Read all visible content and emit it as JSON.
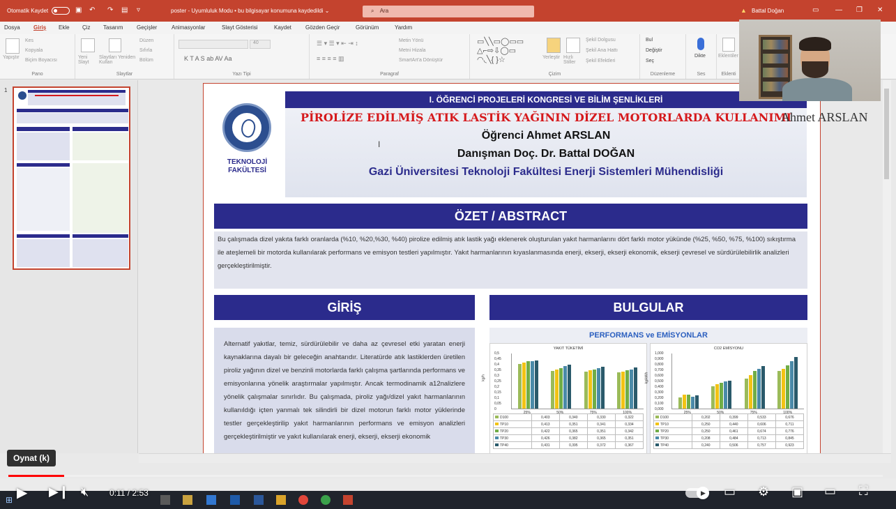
{
  "titlebar": {
    "autosave": "Otomatik Kaydet",
    "document": "poster  -  Uyumluluk Modu  •  bu bilgisayar konumuna kaydedildi  ⌄",
    "search_placeholder": "Ara",
    "user": "Battal Doğan"
  },
  "ribbon": {
    "tabs": [
      "Dosya",
      "Giriş",
      "Ekle",
      "Çiz",
      "Tasarım",
      "Geçişler",
      "Animasyonlar",
      "Slayt Gösterisi",
      "Kaydet",
      "Gözden Geçir",
      "Görünüm",
      "Yardım"
    ],
    "groups": {
      "pano": "Pano",
      "slaytlar": "Slaytlar",
      "yazi_tipi": "Yazı Tipi",
      "paragraf": "Paragraf",
      "cizim": "Çizim",
      "duzenleme": "Düzenleme",
      "ses": "Ses",
      "eklentiler": "Eklenti"
    },
    "items": {
      "yapistir": "Yapıştır",
      "kes": "Kes",
      "kopyala": "Kopyala",
      "bicim_boyacisi": "Biçim Boyacısı",
      "yeni_slayt": "Yeni Slayt",
      "slayti_yeniden": "Slaytları Yeniden Kullan",
      "duzen": "Düzen",
      "sifirla": "Sıfırla",
      "bolum": "Bölüm",
      "font_size": "40",
      "metin_yonu": "Metin Yönü",
      "metni_hizala": "Metni Hizala",
      "smartart": "SmartArt'a Dönüştür",
      "yerlestir": "Yerleştir",
      "hizli_stiller": "Hızlı Stiller",
      "sekil_dolgusu": "Şekil Dolgusu",
      "sekil_ana_hatti": "Şekil Ana Hattı",
      "sekil_efektleri": "Şekil Efektleri",
      "bul": "Bul",
      "degistir": "Değiştir",
      "sec": "Seç",
      "dikte": "Dikte",
      "eklentiler": "Eklentiler"
    }
  },
  "slide_panel": {
    "slide_number": "1"
  },
  "poster": {
    "congress": "I. ÖĞRENCİ PROJELERİ KONGRESİ VE BİLİM ŞENLİKLERİ",
    "title": "PİROLİZE EDİLMİŞ ATIK LASTİK YAĞININ DİZEL MOTORLARDA KULLANIMI",
    "student": "Öğrenci Ahmet ARSLAN",
    "advisor": "Danışman Doç. Dr. Battal DOĞAN",
    "department": "Gazi Üniversitesi Teknoloji Fakültesi Enerji Sistemleri Mühendisliği",
    "faculty_line1": "TEKNOLOJİ",
    "faculty_line2": "FAKÜLTESİ",
    "overlay_name": "Ahmet ARSLAN",
    "abstract_heading": "ÖZET / ABSTRACT",
    "abstract_text": "Bu çalışmada dizel yakıta farklı oranlarda (%10, %20,%30, %40) pirolize edilmiş atık lastik yağı eklenerek oluşturulan yakıt harmanlarını dört farklı motor yükünde (%25, %50, %75, %100) sıkıştırma ile ateşlemeli bir motorda kullanılarak performans ve emisyon testleri yapılmıştır. Yakıt harmanlarının kıyaslanmasında enerji, ekserji, ekserji ekonomik, ekserji çevresel ve sürdürülebilirlik analizleri gerçekleştirilmiştir.",
    "intro_heading": "GİRİŞ",
    "intro_text": "Alternatif yakıtlar, temiz, sürdürülebilir ve daha az çevresel etki yaratan enerji kaynaklarına dayalı bir geleceğin anahtarıdır. Literatürde atık lastiklerden üretilen piroliz yağının dizel ve benzinli motorlarda farklı çalışma şartlarında performans ve emisyonlarına yönelik araştırmalar yapılmıştır. Ancak termodinamik a12nalizlere yönelik çalışmalar sınırlıdır. Bu çalışmada, piroliz yağı/dizel yakıt harmanlarının kullanıldığı içten yanmalı tek silindirli bir dizel motorun farklı motor yüklerinde testler gerçekleştirilip yakıt harmanlarının performans ve emisyon analizleri gerçekleştirilmiştir ve yakıt kullanılarak enerji, ekserji, ekserji ekonomik",
    "results_heading": "BULGULAR",
    "results_subheading": "PERFORMANS ve EMİSYONLAR"
  },
  "chart_data": [
    {
      "type": "bar",
      "title": "YAKIT TÜKETİMİ",
      "ylabel": "kg/h",
      "ylim": [
        0,
        0.5
      ],
      "yticks": [
        "0,5",
        "0,45",
        "0,4",
        "0,35",
        "0,3",
        "0,25",
        "0,2",
        "0,15",
        "0,1",
        "0,05",
        "0"
      ],
      "categories": [
        "25%",
        "50%",
        "75%",
        "100%"
      ],
      "series": [
        {
          "name": "D100",
          "color": "#9bbb59",
          "values": [
            "0,403",
            "0,340",
            "0,330",
            "0,322"
          ]
        },
        {
          "name": "TP10",
          "color": "#f2c314",
          "values": [
            "0,413",
            "0,351",
            "0,341",
            "0,334"
          ]
        },
        {
          "name": "TP20",
          "color": "#70ad47",
          "values": [
            "0,422",
            "0,365",
            "0,351",
            "0,342"
          ]
        },
        {
          "name": "TP30",
          "color": "#4a8aa8",
          "values": [
            "0,426",
            "0,382",
            "0,365",
            "0,351"
          ]
        },
        {
          "name": "TP40",
          "color": "#2a5a6b",
          "values": [
            "0,431",
            "0,395",
            "0,372",
            "0,367"
          ]
        }
      ]
    },
    {
      "type": "bar",
      "title": "CO2 EMİSYONU",
      "ylabel": "kg/kWh",
      "ylim": [
        0,
        1.0
      ],
      "yticks": [
        "1,000",
        "0,900",
        "0,800",
        "0,700",
        "0,600",
        "0,500",
        "0,400",
        "0,300",
        "0,200",
        "0,100",
        "0,000"
      ],
      "categories": [
        "25%",
        "50%",
        "75%",
        "100%"
      ],
      "series": [
        {
          "name": "D100",
          "color": "#9bbb59",
          "values": [
            "0,202",
            "0,399",
            "0,533",
            "0,676"
          ]
        },
        {
          "name": "TP10",
          "color": "#f2c314",
          "values": [
            "0,250",
            "0,440",
            "0,606",
            "0,711"
          ]
        },
        {
          "name": "TP20",
          "color": "#70ad47",
          "values": [
            "0,250",
            "0,461",
            "0,674",
            "0,776"
          ]
        },
        {
          "name": "TP30",
          "color": "#4a8aa8",
          "values": [
            "0,208",
            "0,484",
            "0,713",
            "0,845"
          ]
        },
        {
          "name": "TP40",
          "color": "#2a5a6b",
          "values": [
            "0,240",
            "0,506",
            "0,757",
            "0,923"
          ]
        }
      ]
    }
  ],
  "player": {
    "tooltip": "Oynat (k)",
    "time": "0:11 / 2:53",
    "progress_fraction": 0.064
  },
  "colors": {
    "accent": "#c4432e",
    "poster_blue": "#2b2b8c",
    "title_red": "#d5191c",
    "progress_red": "#ff0000"
  }
}
